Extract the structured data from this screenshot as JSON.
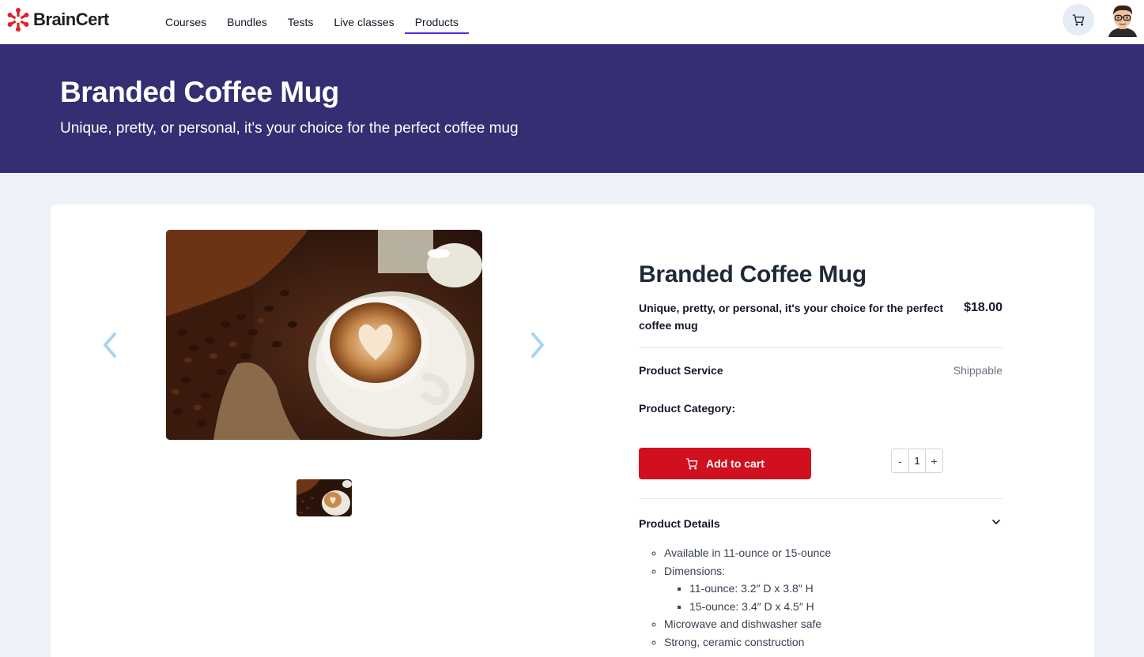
{
  "brand": {
    "name": "BrainCert",
    "accent": "#5b2bd6",
    "logo_color": "#e0202a"
  },
  "nav": {
    "items": [
      {
        "label": "Courses"
      },
      {
        "label": "Bundles"
      },
      {
        "label": "Tests"
      },
      {
        "label": "Live classes"
      },
      {
        "label": "Products",
        "active": true
      }
    ]
  },
  "header_actions": {
    "cart_icon": "shopping-cart-icon",
    "avatar": "user-avatar"
  },
  "hero": {
    "title": "Branded Coffee Mug",
    "subtitle": "Unique, pretty, or personal, it's your choice for the perfect coffee mug",
    "background": "#342f73"
  },
  "product": {
    "title": "Branded Coffee Mug",
    "description": "Unique, pretty, or personal, it's your choice for the perfect coffee mug",
    "price": "$18.00",
    "service_label": "Product Service",
    "service_value": "Shippable",
    "category_label": "Product Category:",
    "add_to_cart": "Add to cart",
    "add_button_color": "#d0101e",
    "quantity": {
      "minus": "-",
      "value": "1",
      "plus": "+"
    },
    "details_heading": "Product Details",
    "details": {
      "item1": "Available in 11-ounce or 15-ounce",
      "item2": "Dimensions:",
      "sub1": "11-ounce: 3.2″ D x 3.8″ H",
      "sub2": "15-ounce: 3.4″ D x 4.5″ H",
      "item3": "Microwave and dishwasher safe",
      "item4": "Strong, ceramic construction"
    }
  }
}
